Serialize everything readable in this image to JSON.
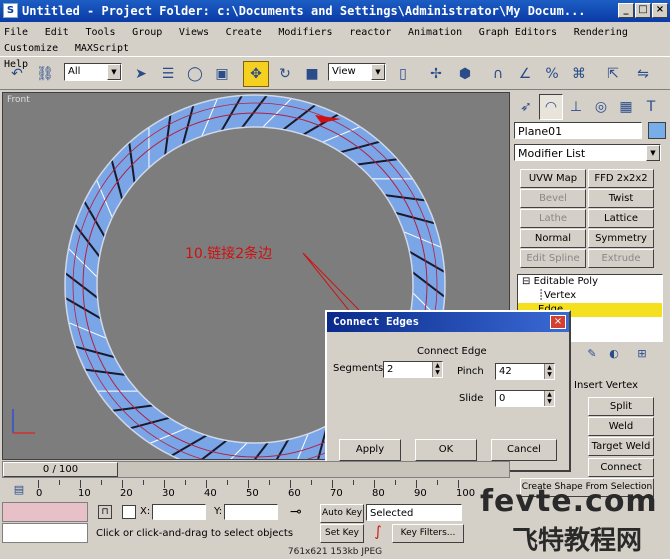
{
  "window": {
    "title": "Untitled - Project Folder: c:\\Documents and Settings\\Administrator\\My Docum..."
  },
  "menu": {
    "row1": [
      "File",
      "Edit",
      "Tools",
      "Group",
      "Views",
      "Create",
      "Modifiers",
      "reactor",
      "Animation",
      "Graph Editors",
      "Rendering",
      "Customize",
      "MAXScript"
    ],
    "row2": [
      "Help"
    ]
  },
  "toolbar": {
    "selection_filter": "All",
    "ref_coord": "View"
  },
  "viewport": {
    "label": "Front",
    "annotation": "10.链接2条边",
    "ring_color": "#7aa6e8",
    "accent": "#d01010"
  },
  "command_panel": {
    "object_name": "Plane01",
    "modifier_list": "Modifier List",
    "buttons": [
      "UVW Map",
      "FFD 2x2x2",
      "Bevel",
      "Twist",
      "Lathe",
      "Lattice",
      "Normal",
      "Symmetry",
      "Edit Spline",
      "Extrude"
    ],
    "stack": [
      "Editable Poly",
      "Vertex",
      "Edge"
    ],
    "lower_buttons": [
      "Split",
      "Weld",
      "Target Weld",
      "Connect",
      "Create Shape From Selection"
    ],
    "lower_partial": "Insert Vertex"
  },
  "dialog": {
    "title": "Connect Edges",
    "group": "Connect Edge",
    "segments_label": "Segments:",
    "segments_value": "2",
    "pinch_label": "Pinch",
    "pinch_value": "42",
    "slide_label": "Slide",
    "slide_value": "0",
    "apply": "Apply",
    "ok": "OK",
    "cancel": "Cancel"
  },
  "timeline": {
    "slider": "0 / 100",
    "ticks": [
      "0",
      "10",
      "20",
      "30",
      "40",
      "50",
      "60",
      "70",
      "80",
      "90",
      "100"
    ]
  },
  "status": {
    "x_label": "X:",
    "y_label": "Y:",
    "prompt": "Click or click-and-drag to select objects",
    "autokey": "Auto Key",
    "setkey": "Set Key",
    "selected": "Selected",
    "key_filters": "Key Filters..."
  },
  "caption": "761x621 153kb JPEG",
  "watermark": {
    "domain": "fevte.com",
    "cn": "飞特教程网"
  }
}
